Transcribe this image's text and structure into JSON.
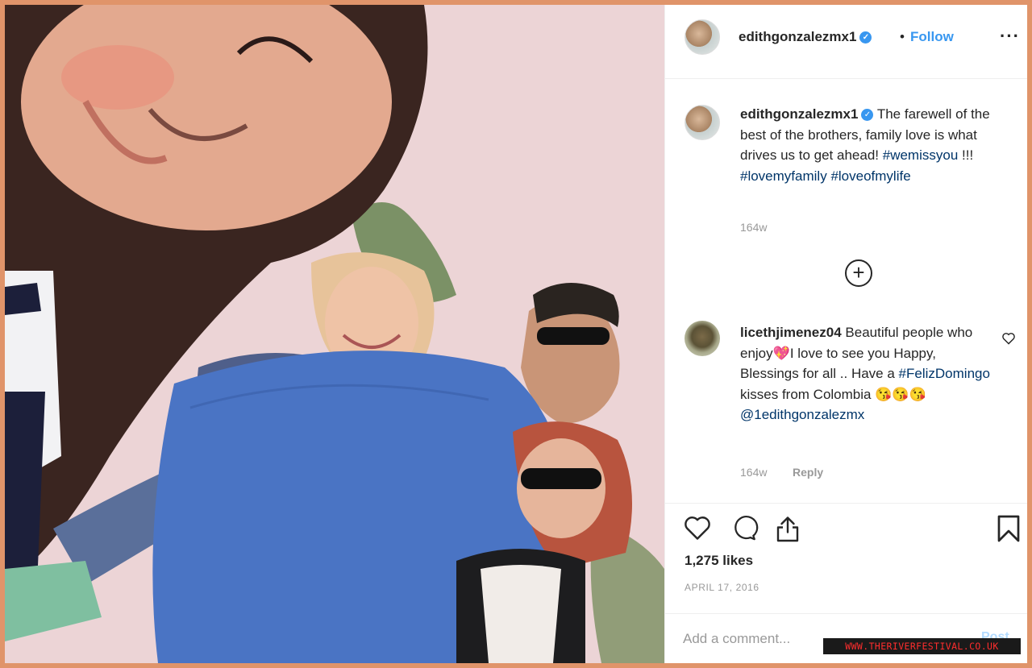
{
  "post": {
    "username": "edithgonzalezmx1",
    "separator": "•",
    "follow_label": "Follow",
    "more_label": "···"
  },
  "caption": {
    "username": "edithgonzalezmx1",
    "text": "The farewell of the best of the brothers, family love is what drives us to get ahead!",
    "tag1": "#wemissyou",
    "exclaim": "!!!",
    "tag2": "#lovemyfamily",
    "tag3": "#loveofmylife",
    "age": "164w"
  },
  "load_more_label": "+",
  "comment": {
    "username": "licethjimenez04",
    "text_a": "Beautiful people who enjoy",
    "emoji_a": "💖",
    "text_b": "I love to see you Happy, Blessings for all .. Have a",
    "tag": "#FelizDomingo",
    "text_c": "kisses from Colombia",
    "emoji_c": "😘😘😘",
    "mention": "@1edithgonzalezmx",
    "age": "164w",
    "reply_label": "Reply"
  },
  "stats": {
    "likes": "1,275 likes",
    "date": "APRIL 17, 2016"
  },
  "add_comment": {
    "placeholder": "Add a comment...",
    "post_label": "Post"
  },
  "watermark": "WWW.THERIVERFESTIVAL.CO.UK",
  "colors": {
    "frame": "#e0946a",
    "link": "#3897f0",
    "hashtag": "#003569",
    "muted": "#999999"
  },
  "icons": [
    "verified-badge-icon",
    "more-options-icon",
    "load-more-plus-icon",
    "comment-like-heart-icon",
    "like-heart-icon",
    "comment-bubble-icon",
    "share-icon",
    "bookmark-icon"
  ]
}
